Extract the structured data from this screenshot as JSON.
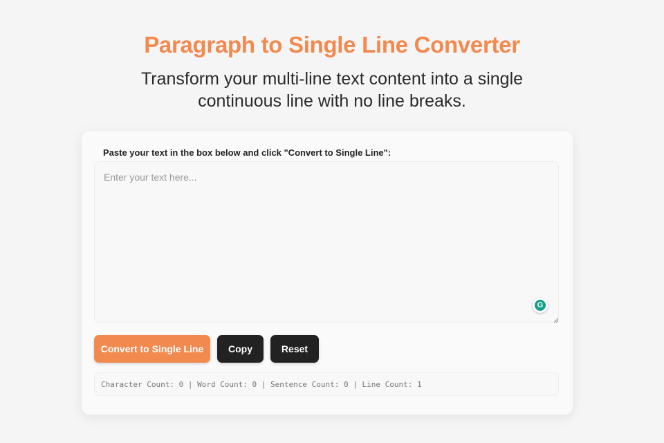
{
  "header": {
    "title": "Paragraph to Single Line Converter",
    "subtitle": "Transform your multi-line text content into a single continuous line with no line breaks."
  },
  "converter": {
    "instruction": "Paste your text in the box below and click \"Convert to Single Line\":",
    "input_value": "",
    "input_placeholder": "Enter your text here...",
    "grammarly_icon": "grammarly-icon",
    "buttons": {
      "convert_label": "Convert to Single Line",
      "copy_label": "Copy",
      "reset_label": "Reset"
    },
    "stats_text": "Character Count: 0 | Word Count: 0 | Sentence Count: 0 | Line Count: 1"
  },
  "colors": {
    "accent": "#f2894e",
    "dark_button": "#222222",
    "background": "#f5f5f5"
  }
}
